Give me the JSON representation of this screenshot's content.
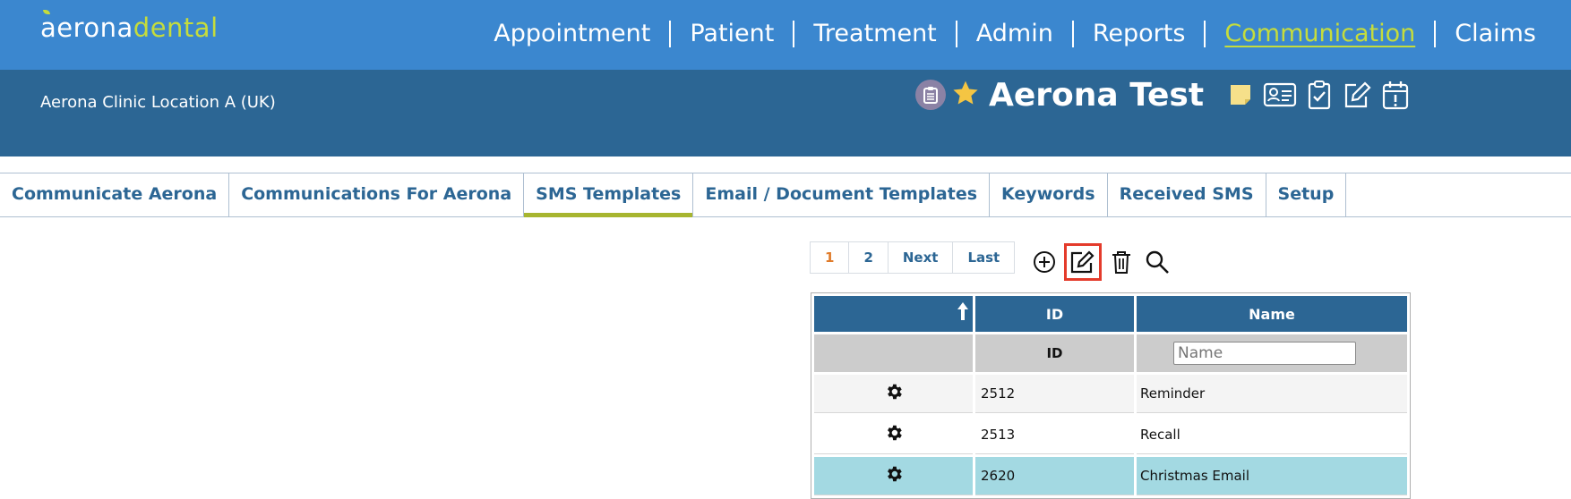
{
  "header": {
    "logo_part1": "aerona",
    "logo_part2": "dental",
    "nav": [
      {
        "label": "Appointment",
        "active": false
      },
      {
        "label": "Patient",
        "active": false
      },
      {
        "label": "Treatment",
        "active": false
      },
      {
        "label": "Admin",
        "active": false
      },
      {
        "label": "Reports",
        "active": false
      },
      {
        "label": "Communication",
        "active": true
      },
      {
        "label": "Claims",
        "active": false
      }
    ]
  },
  "subheader": {
    "clinic": "Aerona Clinic Location A (UK)",
    "patient_name": "Aerona Test",
    "icons": [
      "clipboard-badge-icon",
      "star-icon",
      "sticky-note-icon",
      "id-card-icon",
      "clipboard-check-icon",
      "edit-icon",
      "calendar-alert-icon"
    ]
  },
  "tabs": [
    {
      "label": "Communicate Aerona",
      "active": false
    },
    {
      "label": "Communications For Aerona",
      "active": false
    },
    {
      "label": "SMS Templates",
      "active": true
    },
    {
      "label": "Email / Document Templates",
      "active": false
    },
    {
      "label": "Keywords",
      "active": false
    },
    {
      "label": "Received SMS",
      "active": false
    },
    {
      "label": "Setup",
      "active": false
    }
  ],
  "pager": {
    "pages": [
      "1",
      "2"
    ],
    "current": "1",
    "next": "Next",
    "last": "Last"
  },
  "toolbar": [
    "add-icon",
    "edit-icon",
    "delete-icon",
    "search-icon"
  ],
  "grid": {
    "columns": [
      "",
      "ID",
      "Name"
    ],
    "filter_id_label": "ID",
    "filter_name_placeholder": "Name",
    "rows": [
      {
        "id": "2512",
        "name": "Reminder",
        "selected": false
      },
      {
        "id": "2513",
        "name": "Recall",
        "selected": false
      },
      {
        "id": "2620",
        "name": "Christmas Email",
        "selected": true
      }
    ]
  },
  "colors": {
    "top_bar": "#3b87cf",
    "sub_bar": "#2c6694",
    "accent": "#c5dc3c",
    "tab_underline": "#a7b52f",
    "selected_row": "#a3d9e2",
    "highlight_box": "#e43b2b"
  }
}
